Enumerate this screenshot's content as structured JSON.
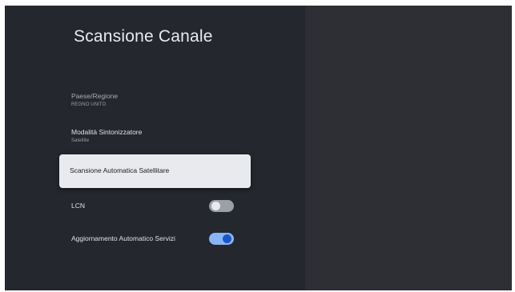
{
  "page": {
    "title": "Scansione Canale"
  },
  "settings": {
    "country": {
      "label": "Paese/Regione",
      "value": "REGNO UNITO"
    },
    "tuner": {
      "label": "Modalità Sintonizzatore",
      "value": "Satellite"
    },
    "auto_scan": {
      "label": "Scansione Automatica Satellitare"
    },
    "lcn": {
      "label": "LCN",
      "enabled": false
    },
    "auto_update": {
      "label": "Aggiornamento Automatico Servizi",
      "enabled": true
    }
  },
  "colors": {
    "background": "#24272d",
    "right_panel": "#2d2f34",
    "focus_card": "#e8eaed",
    "toggle_on_track": "#8ab4f8",
    "toggle_on_knob": "#1a56c4",
    "toggle_off_track": "#9aa0a6"
  }
}
